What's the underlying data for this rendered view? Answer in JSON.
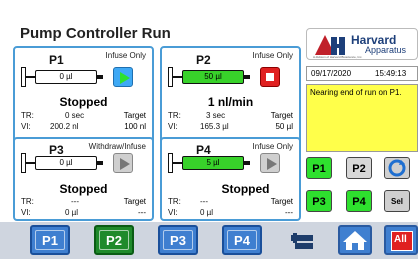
{
  "header": {
    "title": "Pump Controller Run"
  },
  "panels": [
    {
      "id": "P1",
      "mode": "Infuse Only",
      "syringe_value": "0 µl",
      "status": "Stopped",
      "tr_label": "TR:",
      "tr": "0 sec",
      "vi_label": "VI:",
      "vi": "200.2 nl",
      "target_label": "Target",
      "target": "100 nl",
      "button": "run"
    },
    {
      "id": "P2",
      "mode": "Infuse Only",
      "syringe_value": "50 µl",
      "status": "1 nl/min",
      "tr_label": "TR:",
      "tr": "3 sec",
      "vi_label": "VI:",
      "vi": "165.3 µl",
      "target_label": "Target",
      "target": "50 µl",
      "button": "stop"
    },
    {
      "id": "P3",
      "mode": "Withdraw/Infuse",
      "syringe_value": "0 µl",
      "status": "Stopped",
      "tr_label": "TR:",
      "tr": "---",
      "vi_label": "VI:",
      "vi": "0 µl",
      "target_label": "Target",
      "target": "---",
      "button": "run-grey"
    },
    {
      "id": "P4",
      "mode": "Infuse Only",
      "syringe_value": "5 µl",
      "status": "Stopped",
      "tr_label": "TR:",
      "tr": "---",
      "vi_label": "VI:",
      "vi": "0 µl",
      "target_label": "Target",
      "target": "---",
      "button": "run-grey"
    }
  ],
  "logo": {
    "brand_line1": "Harvard",
    "brand_line2": "Apparatus",
    "tagline": "A division of Harvard Bioscience, Inc."
  },
  "datetime": {
    "date": "09/17/2020",
    "time": "15:49:13"
  },
  "message": {
    "text": "Nearing end of run on P1."
  },
  "pump_buttons": [
    "P1",
    "P2",
    "P3",
    "P4"
  ],
  "side_buttons": {
    "sel_label": "Sel"
  },
  "bottom_tabs": [
    "P1",
    "P2",
    "P3",
    "P4"
  ],
  "bottom_icons": {
    "settings": "settings-icon",
    "home": "home-icon",
    "all_label": "All"
  }
}
